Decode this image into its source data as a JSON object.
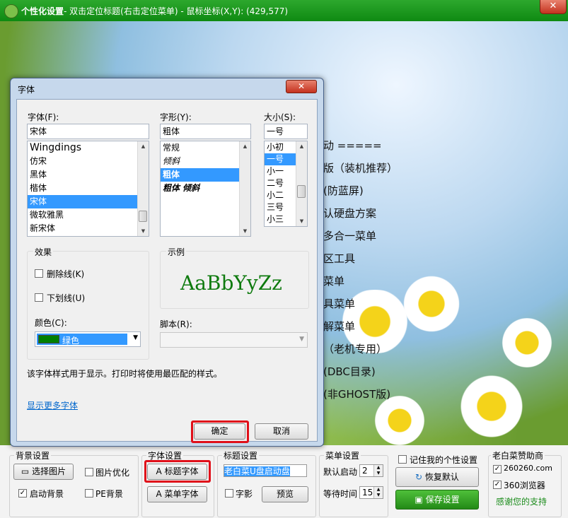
{
  "window": {
    "title_app": "个性化设置",
    "title_rest": "- 双击定位标题(右击定位菜单) - 鼠标坐标(X,Y): (429,577)",
    "close_glyph": "✕"
  },
  "menu_preview": [
    "动 =====",
    "版（装机推荐）",
    "(防蓝屏)",
    "认硬盘方案",
    "多合一菜单",
    "区工具",
    "菜单",
    "具菜单",
    "解菜单",
    "（老机专用）",
    "(DBC目录)",
    "(非GHOST版)"
  ],
  "dialog": {
    "title": "字体",
    "close_glyph": "✕",
    "font_label": "字体(F):",
    "font_value": "宋体",
    "font_items": [
      {
        "label": "Wingdings",
        "selected": false
      },
      {
        "label": "仿宋",
        "selected": false
      },
      {
        "label": "黑体",
        "selected": false
      },
      {
        "label": "楷体",
        "selected": false
      },
      {
        "label": "宋体",
        "selected": true
      },
      {
        "label": "微软雅黑",
        "selected": false
      },
      {
        "label": "新宋体",
        "selected": false
      }
    ],
    "style_label": "字形(Y):",
    "style_value": "粗体",
    "style_items": [
      {
        "label": "常规",
        "selected": false
      },
      {
        "label": "倾斜",
        "selected": false
      },
      {
        "label": "粗体",
        "selected": true
      },
      {
        "label": "粗体 倾斜",
        "selected": false
      }
    ],
    "size_label": "大小(S):",
    "size_value": "一号",
    "size_items": [
      {
        "label": "小初",
        "selected": false
      },
      {
        "label": "一号",
        "selected": true
      },
      {
        "label": "小一",
        "selected": false
      },
      {
        "label": "二号",
        "selected": false
      },
      {
        "label": "小二",
        "selected": false
      },
      {
        "label": "三号",
        "selected": false
      },
      {
        "label": "小三",
        "selected": false
      }
    ],
    "effects_title": "效果",
    "strikeout_label": "删除线(K)",
    "underline_label": "下划线(U)",
    "color_label": "颜色(C):",
    "color_value": "绿色",
    "color_swatch": "#008000",
    "sample_title": "示例",
    "sample_text": "AaBbYyZz",
    "script_label": "脚本(R):",
    "script_value": "",
    "description": "该字体样式用于显示。打印时将使用最匹配的样式。",
    "more_fonts_link": "显示更多字体",
    "ok_label": "确定",
    "cancel_label": "取消"
  },
  "bottom": {
    "bg_group": "背景设置",
    "choose_image": "选择图片",
    "image_optimize": "图片优化",
    "enable_bg": "启动背景",
    "enable_bg_checked": true,
    "pe_bg": "PE背景",
    "font_group": "字体设置",
    "title_font": "标题字体",
    "menu_font": "菜单字体",
    "title_group": "标题设置",
    "title_value": "老白菜U盘启动盘",
    "shadow": "字影",
    "preview": "预览",
    "menu_group": "菜单设置",
    "default_start": "默认启动",
    "default_start_value": "2",
    "wait_time": "等待时间",
    "wait_time_value": "15",
    "remember": "记住我的个性设置",
    "restore": "恢复默认",
    "save": "保存设置",
    "sponsor_group": "老白菜赞助商",
    "sponsor1": "260260.com",
    "sponsor2": "360浏览器",
    "thanks": "感谢您的支持"
  },
  "colors": {
    "title_green": "#17991a",
    "selection": "#3399ff",
    "highlight_red": "#e0101a",
    "sample_green": "#0e7a0e",
    "save_green": "#2f9e1f",
    "thanks_green": "#1c8c1c"
  }
}
